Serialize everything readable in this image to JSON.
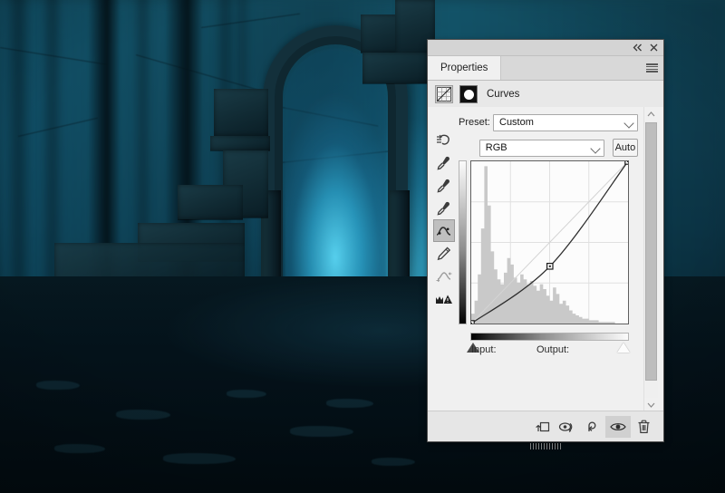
{
  "window": {
    "collapse_label": "«",
    "close_label": "✕"
  },
  "panel": {
    "tab_label": "Properties",
    "menu_icon": "hamburger-menu-icon",
    "adjustment_title": "Curves",
    "adjustment_icon": "curves-grid-icon",
    "mask_icon": "layer-mask-thumbnail"
  },
  "controls": {
    "preset_label": "Preset:",
    "preset_value": "Custom",
    "channel_value": "RGB",
    "auto_label": "Auto",
    "target_adjust_icon": "on-image-adjustment-icon"
  },
  "tools": [
    {
      "name": "on-image-adjustment-tool",
      "selected": false
    },
    {
      "name": "black-point-eyedropper",
      "selected": false
    },
    {
      "name": "gray-point-eyedropper",
      "selected": false
    },
    {
      "name": "white-point-eyedropper",
      "selected": false
    },
    {
      "name": "curve-point-tool",
      "selected": true
    },
    {
      "name": "pencil-draw-tool",
      "selected": false
    },
    {
      "name": "smooth-curve-tool",
      "selected": false
    },
    {
      "name": "clipping-warning-icon",
      "selected": false
    }
  ],
  "graph": {
    "input_label": "Input:",
    "output_label": "Output:",
    "input_value": "",
    "output_value": "",
    "black_slider_name": "black-point-slider",
    "white_slider_name": "white-point-slider"
  },
  "chart_data": {
    "type": "line",
    "title": "Curves",
    "xlabel": "Input",
    "ylabel": "Output",
    "xlim": [
      0,
      255
    ],
    "ylim": [
      0,
      255
    ],
    "grid": true,
    "grid_divisions": 4,
    "legend": "none",
    "series": [
      {
        "name": "RGB curve",
        "points": [
          {
            "input": 0,
            "output": 0
          },
          {
            "input": 128,
            "output": 90
          },
          {
            "input": 255,
            "output": 255
          }
        ],
        "control_points": [
          {
            "input": 0,
            "output": 0
          },
          {
            "input": 128,
            "output": 90
          },
          {
            "input": 255,
            "output": 255
          }
        ]
      },
      {
        "name": "baseline-diagonal",
        "points": [
          {
            "input": 0,
            "output": 0
          },
          {
            "input": 255,
            "output": 255
          }
        ]
      }
    ],
    "histogram": {
      "name": "RGB composite histogram",
      "bins": 48,
      "values": [
        6,
        14,
        30,
        58,
        96,
        72,
        44,
        33,
        27,
        24,
        31,
        40,
        36,
        28,
        25,
        30,
        27,
        24,
        26,
        23,
        20,
        24,
        21,
        17,
        14,
        22,
        18,
        12,
        14,
        11,
        8,
        6,
        5,
        4,
        3,
        3,
        2,
        2,
        2,
        1,
        1,
        1,
        1,
        1,
        0,
        0,
        0,
        0
      ]
    }
  },
  "footer": {
    "buttons": [
      {
        "name": "clip-to-layer-button",
        "icon": "clip-to-layer-icon",
        "active": false
      },
      {
        "name": "view-previous-state-button",
        "icon": "previous-state-icon",
        "active": false
      },
      {
        "name": "reset-adjustment-button",
        "icon": "reset-arrow-icon",
        "active": false
      },
      {
        "name": "toggle-layer-visibility-button",
        "icon": "eye-icon",
        "active": true
      },
      {
        "name": "delete-adjustment-button",
        "icon": "trash-icon",
        "active": false
      }
    ]
  },
  "scrollbar": {
    "up_label": "⌃",
    "down_label": "⌄"
  }
}
